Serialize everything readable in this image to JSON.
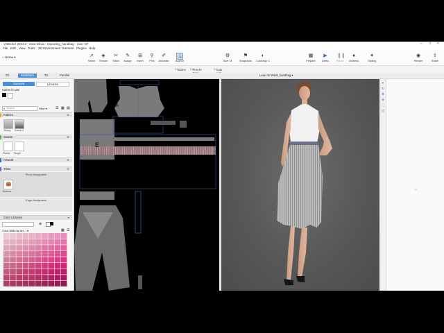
{
  "window": {
    "title": "VStitcher 2021.2 - New-Olivia - Importing_handbag - Size: M*",
    "controls": [
      "–",
      "□",
      "×"
    ]
  },
  "menu": [
    "File",
    "Edit",
    "View",
    "Tools",
    "3D Environment",
    "Garment",
    "Plugins",
    "Help"
  ],
  "home_label": "Home",
  "toolbar": {
    "tools": [
      {
        "label": "Select",
        "icon": "select-arrow-icon"
      },
      {
        "label": "Texture",
        "icon": "texture-icon"
      },
      {
        "label": "Stitch",
        "icon": "stitch-icon"
      },
      {
        "label": "Assign",
        "icon": "assign-icon"
      },
      {
        "label": "Insert",
        "icon": "insert-icon"
      },
      {
        "label": "Pins",
        "icon": "pin-icon"
      },
      {
        "label": "Annotate",
        "icon": "annotate-icon"
      },
      {
        "label": "Anchor",
        "icon": "anchor-icon"
      },
      {
        "label": "Size: M",
        "icon": "size-icon"
      },
      {
        "label": "Snapshots",
        "icon": "snapshot-icon"
      },
      {
        "label": "Colorway: 1",
        "icon": "colorway-icon"
      },
      {
        "label": "Prepare",
        "icon": "prepare-icon"
      },
      {
        "label": "Dress",
        "icon": "dress-play-icon"
      },
      {
        "label": "Pause",
        "icon": "pause-icon"
      },
      {
        "label": "Undress",
        "icon": "undress-icon"
      },
      {
        "label": "Styling",
        "icon": "styling-icon"
      },
      {
        "label": "Render",
        "icon": "render-camera-icon"
      },
      {
        "label": "Share",
        "icon": "share-icon"
      }
    ]
  },
  "options": {
    "gizmo": "Gizmo",
    "freeze": "Freeze Pose",
    "auto_link": "Auto Link",
    "avatar_pose": "Lean on Waist_handbag"
  },
  "view_tabs": [
    "2D",
    "Bookmark",
    "3D",
    "Parallel"
  ],
  "left_panel": {
    "segments": [
      "Garment",
      "Libraries"
    ],
    "colors_in_use": "Colors in Use",
    "search_placeholder": "Search",
    "filter": "Filter",
    "fabrics": "Fabrics",
    "fabric_items": [
      "Jersey",
      "Group 1"
    ],
    "seams": "Seams",
    "seam_items": [
      "Plastic",
      "Single"
    ],
    "artwork": "Artwork",
    "trims": "Trims",
    "piece_assignable": "Piece Assignable",
    "trim_item": "Buttons",
    "edge_assignable": "Edge Assignable",
    "color_libraries": "Color Libraries",
    "color_atlas": "Color Atlas by Arc..."
  },
  "colors": {
    "accent_blue": "#4a90d9",
    "fabric_orange": "#f0a33a",
    "seam_green": "#5bb34a",
    "artwork_blue": "#3b6cb7",
    "trims_purple": "#8e5bc8",
    "swatch_pink": "#e87fa4"
  }
}
